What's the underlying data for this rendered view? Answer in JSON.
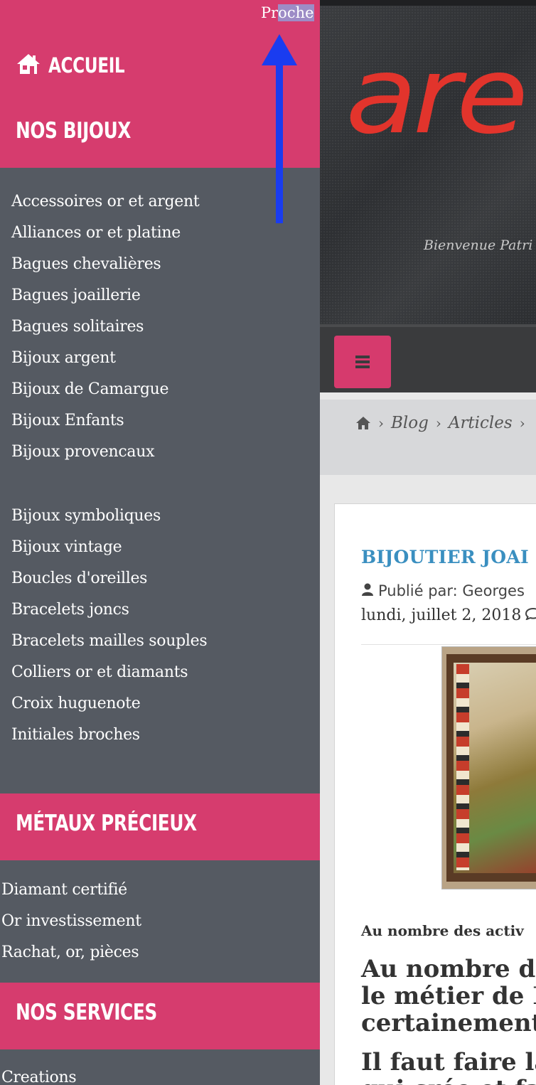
{
  "offcanvas": {
    "close_link": {
      "prefix": "Pr",
      "selected": "oche"
    },
    "home_label": "ACCUEIL",
    "sections": {
      "bijoux": {
        "heading": "NOS BIJOUX",
        "items_a": [
          "Accessoires or et argent",
          "Alliances or et platine",
          "Bagues chevalières",
          "Bagues joaillerie",
          "Bagues solitaires",
          "Bijoux argent",
          "Bijoux de Camargue",
          "Bijoux Enfants",
          "Bijoux provencaux"
        ],
        "items_b": [
          "Bijoux symboliques",
          "Bijoux vintage",
          "Boucles d'oreilles",
          "Bracelets joncs",
          "Bracelets mailles souples",
          "Colliers or et diamants",
          "Croix huguenote",
          "Initiales broches"
        ]
      },
      "metaux": {
        "heading": "MÉTAUX PRÉCIEUX",
        "items": [
          "Diamant certifié",
          "Or investissement",
          "Rachat, or, pièces"
        ]
      },
      "services": {
        "heading": "NOS SERVICES",
        "items": [
          "Creations"
        ]
      }
    }
  },
  "header": {
    "logo_text": "are",
    "welcome": "Bienvenue Patri"
  },
  "breadcrumb": {
    "items": [
      "Blog",
      "Articles"
    ]
  },
  "article": {
    "title": "BIJOUTIER JOAI",
    "meta_author": "Publié par: Georges",
    "meta_date": "lundi, juillet 2, 2018",
    "intro": "Au nombre des activ",
    "h2_lines": [
      "Au nombre de",
      "le métier de B",
      "certainement"
    ],
    "h3_lines": [
      "Il faut faire la",
      "qui crée et fab"
    ]
  },
  "colors": {
    "accent_pink": "#d63c6e",
    "menu_bg": "#555a62",
    "title_blue": "#3a8fc0",
    "logo_red": "#e2342c",
    "arrow_blue": "#1a3cf0"
  }
}
